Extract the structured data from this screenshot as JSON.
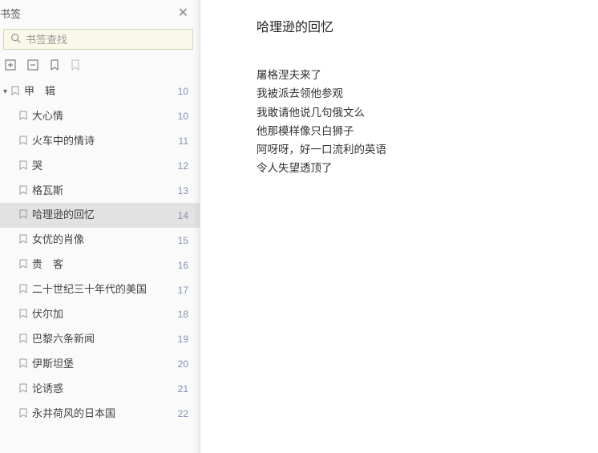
{
  "sidebar": {
    "tab_label": "书签",
    "close_label": "✕"
  },
  "search": {
    "placeholder": "书签查找"
  },
  "toolbar": {
    "add_icon": "⊞",
    "collapse_icon": "⊟",
    "bm_icon": "🔖",
    "bm2_icon": "🔖"
  },
  "toc": [
    {
      "label": "甲　辑",
      "page": "10",
      "level": 0,
      "expandable": true,
      "selected": false
    },
    {
      "label": "大心情",
      "page": "10",
      "level": 1,
      "selected": false
    },
    {
      "label": "火车中的情诗",
      "page": "11",
      "level": 1,
      "selected": false
    },
    {
      "label": "哭",
      "page": "12",
      "level": 1,
      "selected": false
    },
    {
      "label": "格瓦斯",
      "page": "13",
      "level": 1,
      "selected": false
    },
    {
      "label": "哈理逊的回忆",
      "page": "14",
      "level": 1,
      "selected": true
    },
    {
      "label": "女优的肖像",
      "page": "15",
      "level": 1,
      "selected": false
    },
    {
      "label": "贵　客",
      "page": "16",
      "level": 1,
      "selected": false
    },
    {
      "label": "二十世纪三十年代的美国",
      "page": "17",
      "level": 1,
      "selected": false
    },
    {
      "label": "伏尔加",
      "page": "18",
      "level": 1,
      "selected": false
    },
    {
      "label": "巴黎六条新闻",
      "page": "19",
      "level": 1,
      "selected": false
    },
    {
      "label": "伊斯坦堡",
      "page": "20",
      "level": 1,
      "selected": false
    },
    {
      "label": "论诱惑",
      "page": "21",
      "level": 1,
      "selected": false
    },
    {
      "label": "永井荷风的日本国",
      "page": "22",
      "level": 1,
      "selected": false
    }
  ],
  "content": {
    "title": "哈理逊的回忆",
    "lines": [
      "屠格涅夫来了",
      "我被派去领他参观",
      "我敢请他说几句俄文么",
      "他那模样像只白狮子",
      "阿呀呀，好一口流利的英语",
      "令人失望透顶了"
    ]
  }
}
